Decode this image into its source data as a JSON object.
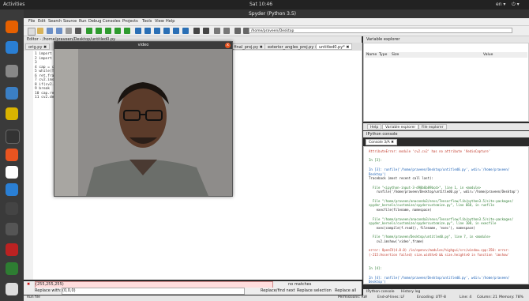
{
  "system": {
    "activities": "Activities",
    "clock": "Sat 10:46",
    "lang": "en ▾"
  },
  "window": {
    "title": "Spyder (Python 3.5)"
  },
  "menu": [
    "File",
    "Edit",
    "Search",
    "Source",
    "Run",
    "Debug",
    "Consoles",
    "Projects",
    "Tools",
    "View",
    "Help"
  ],
  "toolbar": {
    "path": "/home/praveen/Desktop"
  },
  "editor": {
    "header": "Editor - /home/praveen/Desktop/untitled0.py",
    "tabs": [
      {
        "label": "orig.py ✖"
      },
      {
        "label": "t_final_proj.py ✖"
      },
      {
        "label": "exterior_angles_proj.py ✖"
      },
      {
        "label": "untitled0.py* ✖"
      }
    ],
    "code": [
      "1 import cv2",
      "2 import numpy as np",
      "3",
      "4 cap = cv2.VideoCapture(0)",
      "5 while(True):",
      "6     ret,frame = cap.read()",
      "7     cv2.imshow('video',frame)",
      "8     if(cv2.waitKey(1) & 0xFF == ord('q')):",
      "9         break",
      "10 cap.release()",
      "11 cv2.destroyAllWindows()"
    ]
  },
  "video_window": {
    "title": "video",
    "close": "x"
  },
  "right": {
    "header": "Variable explorer",
    "columns": {
      "name": "Name",
      "type": "Type",
      "size": "Size",
      "value": "Value"
    },
    "pane_tabs": [
      "Help",
      "Variable explorer",
      "File explorer"
    ],
    "console_header": "IPython console",
    "console_tab": "Console 3/A ✖"
  },
  "console": {
    "lines": [
      {
        "t": "AttributeError: module 'cv2.cv2' has no attribute 'VedioCapture'",
        "c": "red"
      },
      {
        "t": "",
        "c": ""
      },
      {
        "t": "In [3]:",
        "c": "green"
      },
      {
        "t": "",
        "c": ""
      },
      {
        "t": "In [3]: runfile('/home/praveen/Desktop/untitled0.py', wdir='/home/praveen/",
        "c": "blue"
      },
      {
        "t": "Desktop')",
        "c": "blue"
      },
      {
        "t": "Traceback (most recent call last):",
        "c": ""
      },
      {
        "t": "",
        "c": ""
      },
      {
        "t": "  File \"<ipython-input-3-d90b6b89bcd>\", line 1, in <module>",
        "c": "green"
      },
      {
        "t": "    runfile('/home/praveen/Desktop/untitled0.py', wdir='/home/praveen/Desktop')",
        "c": ""
      },
      {
        "t": "",
        "c": ""
      },
      {
        "t": "  File \"/home/praveen/anaconda3/envs/Tensorflow/lib/python3.5/site-packages/",
        "c": "green"
      },
      {
        "t": "spyder_kernels/customize/spydercustomize.py\", line 668, in runfile",
        "c": "green"
      },
      {
        "t": "    execfile(filename, namespace)",
        "c": ""
      },
      {
        "t": "",
        "c": ""
      },
      {
        "t": "  File \"/home/praveen/anaconda3/envs/Tensorflow/lib/python3.5/site-packages/",
        "c": "green"
      },
      {
        "t": "spyder_kernels/customize/spydercustomize.py\", line 108, in execfile",
        "c": "green"
      },
      {
        "t": "    exec(compile(f.read(), filename, 'exec'), namespace)",
        "c": ""
      },
      {
        "t": "",
        "c": ""
      },
      {
        "t": "  File \"/home/praveen/Desktop/untitled0.py\", line 7, in <module>",
        "c": "green"
      },
      {
        "t": "    cv2.imshow('video',frame)",
        "c": ""
      },
      {
        "t": "",
        "c": ""
      },
      {
        "t": "error: OpenCV(4.0.0) /io/opencv/modules/highgui/src/window.cpp:350: error:",
        "c": "red"
      },
      {
        "t": "(-215:Assertion failed) size.width>0 && size.height>0 in function 'imshow'",
        "c": "red"
      },
      {
        "t": "",
        "c": ""
      },
      {
        "t": "",
        "c": ""
      },
      {
        "t": "In [4]:",
        "c": "green"
      },
      {
        "t": "",
        "c": ""
      },
      {
        "t": "In [4]: runfile('/home/praveen/Desktop/untitled0.py', wdir='/home/praveen/",
        "c": "blue"
      },
      {
        "t": "Desktop')",
        "c": "blue"
      }
    ]
  },
  "find": {
    "value": "(255,255,255)",
    "matches": "no matches"
  },
  "replace": {
    "label": "Replace with:",
    "value": "(0,0,0)",
    "replace_find": "Replace/find next",
    "replace_sel": "Replace selection",
    "replace_all": "Replace all"
  },
  "bottom_tabs": [
    "IPython console",
    "History log"
  ],
  "status": {
    "left": "Run file",
    "permissions": "Permissions: RW",
    "eol": "End-of-lines: LF",
    "encoding": "Encoding: UTF-8",
    "line": "Line: 4",
    "column": "Column: 21",
    "memory": "Memory: 78%"
  }
}
